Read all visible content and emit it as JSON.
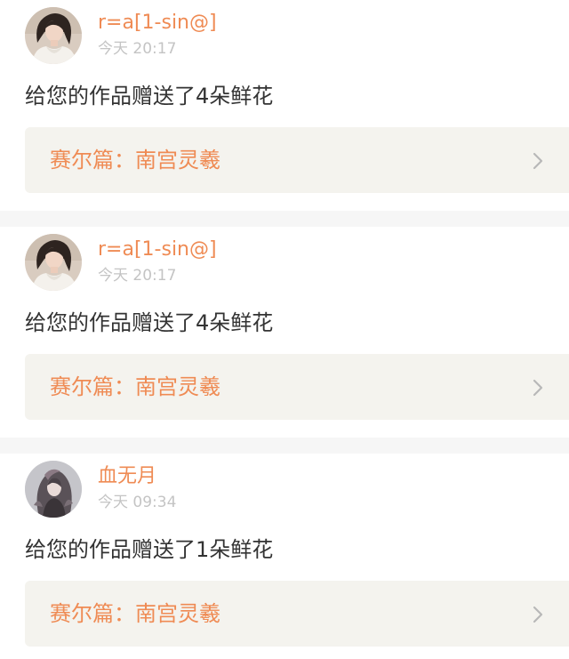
{
  "notifications": [
    {
      "username": "r=a[1-sin@]",
      "avatar_icon": "woman-portrait-avatar",
      "time": "今天 20:17",
      "message": "给您的作品赠送了4朵鲜花",
      "work_title": "赛尔篇：南宫灵羲",
      "chevron_icon": "chevron-right-icon"
    },
    {
      "username": "r=a[1-sin@]",
      "avatar_icon": "woman-portrait-avatar",
      "time": "今天 20:17",
      "message": "给您的作品赠送了4朵鲜花",
      "work_title": "赛尔篇：南宫灵羲",
      "chevron_icon": "chevron-right-icon"
    },
    {
      "username": "血无月",
      "avatar_icon": "anime-character-avatar",
      "time": "今天 09:34",
      "message": "给您的作品赠送了1朵鲜花",
      "work_title": "赛尔篇：南宫灵羲",
      "chevron_icon": "chevron-right-icon"
    }
  ],
  "colors": {
    "accent": "#ef8b54",
    "muted_text": "#c4c4c4",
    "body_text": "#333333",
    "link_bg": "#f4f3ee",
    "divider_bg": "#f6f6f6"
  }
}
